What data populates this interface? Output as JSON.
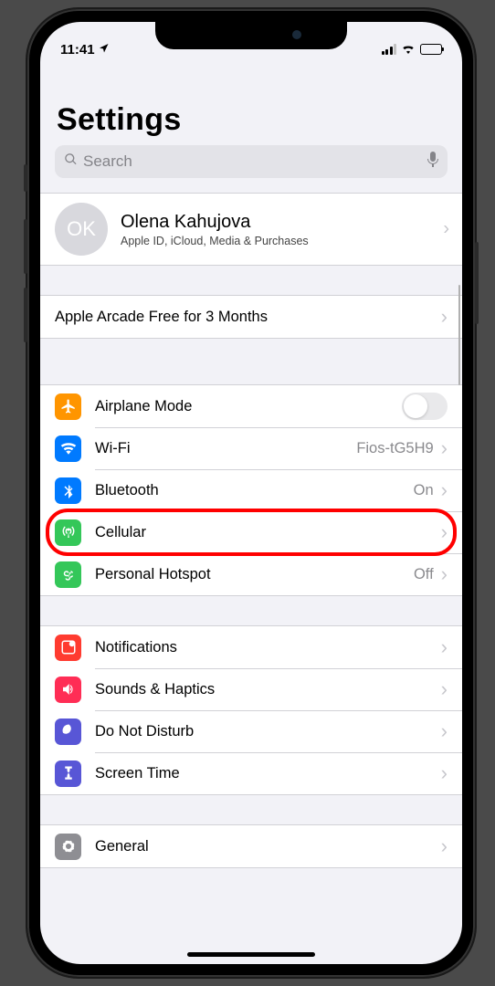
{
  "status": {
    "time": "11:41",
    "location_icon": "◤"
  },
  "title": "Settings",
  "search": {
    "placeholder": "Search"
  },
  "profile": {
    "initials": "OK",
    "name": "Olena Kahujova",
    "subtitle": "Apple ID, iCloud, Media & Purchases"
  },
  "promo": {
    "label": "Apple Arcade Free for 3 Months"
  },
  "connectivity": {
    "airplane": {
      "label": "Airplane Mode",
      "on": false
    },
    "wifi": {
      "label": "Wi-Fi",
      "detail": "Fios-tG5H9"
    },
    "bluetooth": {
      "label": "Bluetooth",
      "detail": "On"
    },
    "cellular": {
      "label": "Cellular"
    },
    "hotspot": {
      "label": "Personal Hotspot",
      "detail": "Off"
    }
  },
  "notifications_group": {
    "notifications": {
      "label": "Notifications"
    },
    "sounds": {
      "label": "Sounds & Haptics"
    },
    "dnd": {
      "label": "Do Not Disturb"
    },
    "screentime": {
      "label": "Screen Time"
    }
  },
  "general_group": {
    "general": {
      "label": "General"
    }
  },
  "highlighted_row": "cellular"
}
